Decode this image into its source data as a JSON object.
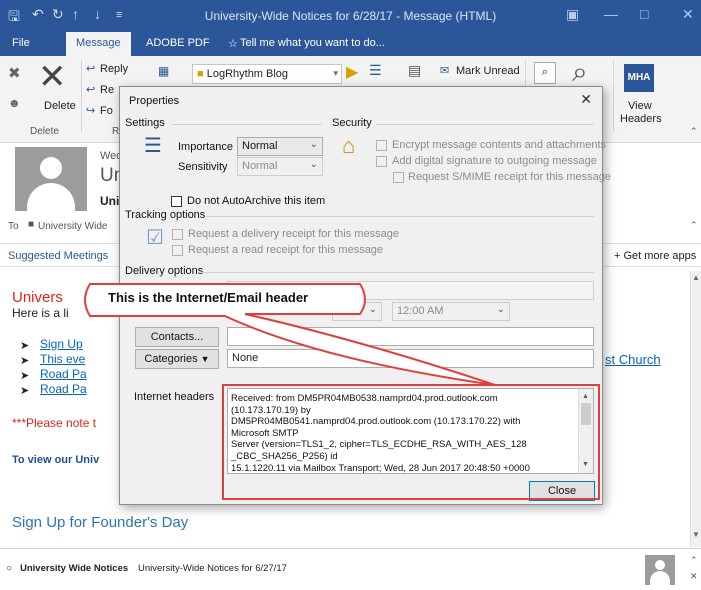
{
  "window": {
    "title": "University-Wide Notices for 6/28/17 - Message (HTML)"
  },
  "tabs": [
    {
      "label": "File"
    },
    {
      "label": "Message"
    },
    {
      "label": "ADOBE PDF"
    },
    {
      "label": "Tell me what you want to do..."
    }
  ],
  "ribbon": {
    "delete_label": "Delete",
    "delete_group": "Delete",
    "reply_label": "Reply",
    "reply_all_label": "Re",
    "forward_label": "Fo",
    "respond_group": "R",
    "quickstep_combo": "LogRhythm Blog",
    "mark_unread_label": "Mark Unread",
    "view_headers_l1": "View",
    "view_headers_l2": "Headers",
    "mha_badge": "MHA"
  },
  "message": {
    "date_prefix": "Wed",
    "sender_initial": "Un",
    "subject_prefix": "Uni",
    "to_label": "To",
    "to_value": "University Wide",
    "suggested_meetings": "Suggested Meetings",
    "get_more_apps": "+  Get more apps",
    "heading_red": "Univers",
    "intro": "Here is a li",
    "bullets": [
      "Sign Up",
      "This eve",
      "Road Pa",
      "Road Pa"
    ],
    "right_link": "st Church",
    "note_red": "***Please note t",
    "view_prompt": "To view our Univ",
    "founders": "Sign Up for Founder's Day",
    "bottom_sender": "University Wide Notices",
    "bottom_subject": "University-Wide Notices for 6/27/17"
  },
  "dialog": {
    "title": "Properties",
    "settings_label": "Settings",
    "security_label": "Security",
    "importance_label": "Importance",
    "importance_value": "Normal",
    "sensitivity_label": "Sensitivity",
    "sensitivity_value": "Normal",
    "encrypt_label": "Encrypt message contents and attachments",
    "signature_label": "Add digital signature to outgoing message",
    "smime_label": "Request S/MIME receipt for this message",
    "autoarchive_label": "Do not AutoArchive this item",
    "tracking_label": "Tracking options",
    "delivery_receipt_label": "Request a delivery receipt for this message",
    "read_receipt_label": "Request a read receipt for this message",
    "delivery_label": "Delivery options",
    "time_value": "12:00 AM",
    "contacts_button": "Contacts...",
    "categories_button": "Categories",
    "categories_value": "None",
    "internet_headers_label": "Internet headers",
    "headers_lines": [
      "Received: from DM5PR04MB0538.namprd04.prod.outlook.com",
      "(10.173.170.19) by",
      " DM5PR04MB0541.namprd04.prod.outlook.com (10.173.170.22) with",
      "Microsoft SMTP",
      " Server (version=TLS1_2, cipher=TLS_ECDHE_RSA_WITH_AES_128",
      "_CBC_SHA256_P256) id",
      " 15.1.1220.11 via Mailbox Transport; Wed, 28 Jun 2017 20:48:50 +0000"
    ],
    "close_button": "Close"
  },
  "callout": {
    "text": "This is the Internet/Email header"
  }
}
